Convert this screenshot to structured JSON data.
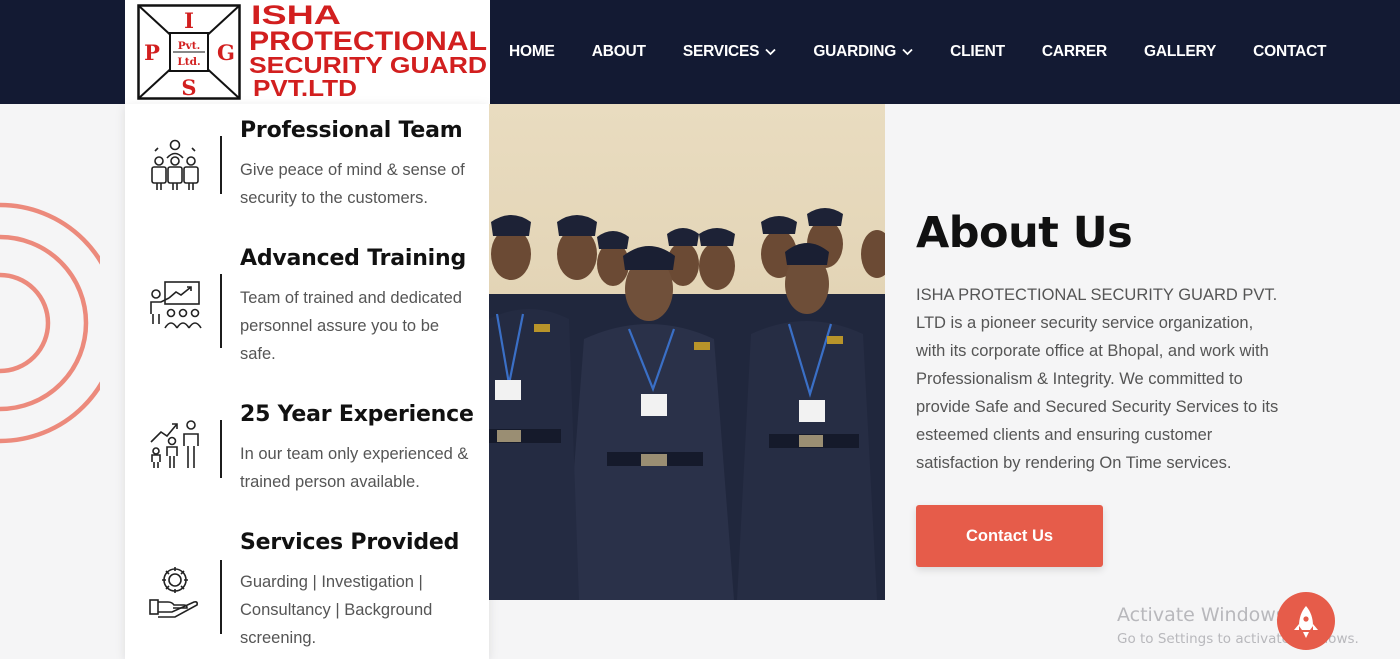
{
  "header": {
    "logo": {
      "letters": [
        "I",
        "P",
        "G",
        "S"
      ],
      "center_line1": "Pvt.",
      "center_line2": "Ltd.",
      "name_line1": "ISHA",
      "name_line2": "PROTECTIONAL",
      "name_line3": "SECURITY GUARD",
      "name_line4": "PVT.LTD"
    },
    "nav": [
      {
        "label": "HOME"
      },
      {
        "label": "ABOUT"
      },
      {
        "label": "SERVICES"
      },
      {
        "label": "GUARDING"
      },
      {
        "label": "CLIENT"
      },
      {
        "label": "CARRER"
      },
      {
        "label": "GALLERY"
      },
      {
        "label": "CONTACT"
      }
    ]
  },
  "features": [
    {
      "title": "Professional Team",
      "desc": "Give peace of mind & sense of security to the customers.",
      "icon": "team-icon"
    },
    {
      "title": "Advanced Training",
      "desc": "Team of trained and dedicated personnel assure you to be safe.",
      "icon": "training-icon"
    },
    {
      "title": "25 Year Experience",
      "desc": "In our team only experienced & trained person available.",
      "icon": "growth-icon"
    },
    {
      "title": "Services Provided",
      "desc": "Guarding | Investigation | Consultancy | Background screening.",
      "icon": "gear-hand-icon"
    }
  ],
  "about": {
    "title": "About Us",
    "text": "ISHA PROTECTIONAL SECURITY GUARD PVT. LTD is a pioneer security service organization, with its corporate office at Bhopal, and work with Professionalism & Integrity. We committed to provide Safe and Secured Security Services to its esteemed clients and ensuring customer satisfaction by rendering On Time services.",
    "button": "Contact Us"
  },
  "watermark": {
    "title": "Activate Windows",
    "subtitle": "Go to Settings to activate Windows."
  },
  "colors": {
    "navbar": "#131a33",
    "accent": "#e65c4a",
    "logo_red": "#d21f1f"
  }
}
